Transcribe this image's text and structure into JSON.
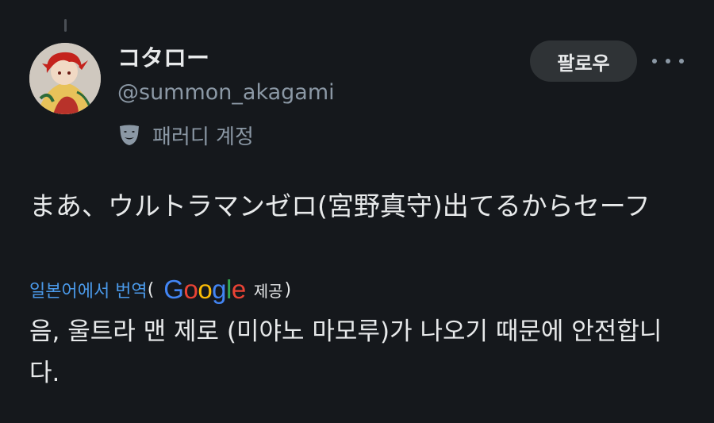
{
  "post": {
    "display_name": "コタロー",
    "handle": "@summon_akagami",
    "parody_label": "패러디 계정",
    "follow_label": "팔로우",
    "text": "まあ、ウルトラマンゼロ(宮野真守)出てるからセーフ",
    "translate_link": "일본어에서 번역",
    "paren_open": "(",
    "paren_close": ")",
    "google_letters": [
      "G",
      "o",
      "o",
      "g",
      "l",
      "e"
    ],
    "provided_label": "제공",
    "translated_text": "음, 울트라 맨 제로 (미야노 마모루)가 나오기 때문에 안전합니다."
  },
  "icons": {
    "avatar": "avatar-image",
    "parody": "theater-mask-icon",
    "more": "more-options-icon"
  },
  "colors": {
    "background": "#15181c",
    "primary_text": "#e7e9ea",
    "secondary_text": "#8b98a5",
    "link": "#4a99e9",
    "button_bg": "#2f3336",
    "google_blue": "#4285f4",
    "google_red": "#ea4335",
    "google_yellow": "#fbbc05",
    "google_green": "#34a853"
  }
}
